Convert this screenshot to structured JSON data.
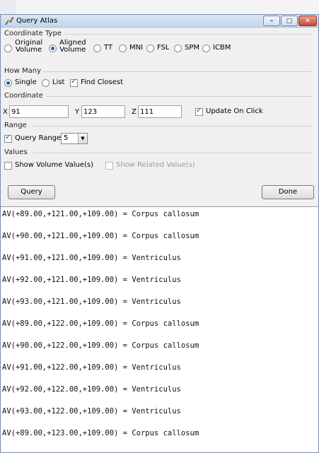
{
  "window": {
    "title": "Query Atlas",
    "controls": [
      "minimize",
      "maximize",
      "close"
    ]
  },
  "coordinate_type": {
    "label": "Coordinate Type",
    "options": [
      {
        "label_line1": "Original",
        "label_line2": "Volume",
        "checked": false
      },
      {
        "label_line1": "Aligned",
        "label_line2": "Volume",
        "checked": true
      },
      {
        "label": "TT",
        "checked": false
      },
      {
        "label": "MNI",
        "checked": false
      },
      {
        "label": "FSL",
        "checked": false
      },
      {
        "label": "SPM",
        "checked": false
      },
      {
        "label": "ICBM",
        "checked": false
      }
    ]
  },
  "how_many": {
    "label": "How Many",
    "single": {
      "label": "Single",
      "checked": true
    },
    "list": {
      "label": "List",
      "checked": false
    },
    "find_closest": {
      "label": "Find Closest",
      "checked": true
    }
  },
  "coordinate": {
    "label": "Coordinate",
    "x": {
      "label": "X",
      "value": "91"
    },
    "y": {
      "label": "Y",
      "value": "123"
    },
    "z": {
      "label": "Z",
      "value": "111"
    },
    "update_on_click": {
      "label": "Update On Click",
      "checked": true
    }
  },
  "range": {
    "label": "Range",
    "query_range": {
      "label": "Query Range:",
      "checked": true,
      "value": "5"
    }
  },
  "values": {
    "label": "Values",
    "show_volume": {
      "label": "Show Volume Value(s)",
      "checked": false
    },
    "show_related": {
      "label": "Show Related Value(s)",
      "checked": false,
      "enabled": false
    }
  },
  "buttons": {
    "query": "Query",
    "done": "Done"
  },
  "results": [
    "AV(+89.00,+121.00,+109.00) = Corpus callosum",
    "AV(+90.00,+121.00,+109.00) = Corpus callosum",
    "AV(+91.00,+121.00,+109.00) = Ventriculus",
    "AV(+92.00,+121.00,+109.00) = Ventriculus",
    "AV(+93.00,+121.00,+109.00) = Ventriculus",
    "AV(+89.00,+122.00,+109.00) = Corpus callosum",
    "AV(+90.00,+122.00,+109.00) = Corpus callosum",
    "AV(+91.00,+122.00,+109.00) = Ventriculus",
    "AV(+92.00,+122.00,+109.00) = Ventriculus",
    "AV(+93.00,+122.00,+109.00) = Ventriculus",
    "AV(+89.00,+123.00,+109.00) = Corpus callosum"
  ]
}
